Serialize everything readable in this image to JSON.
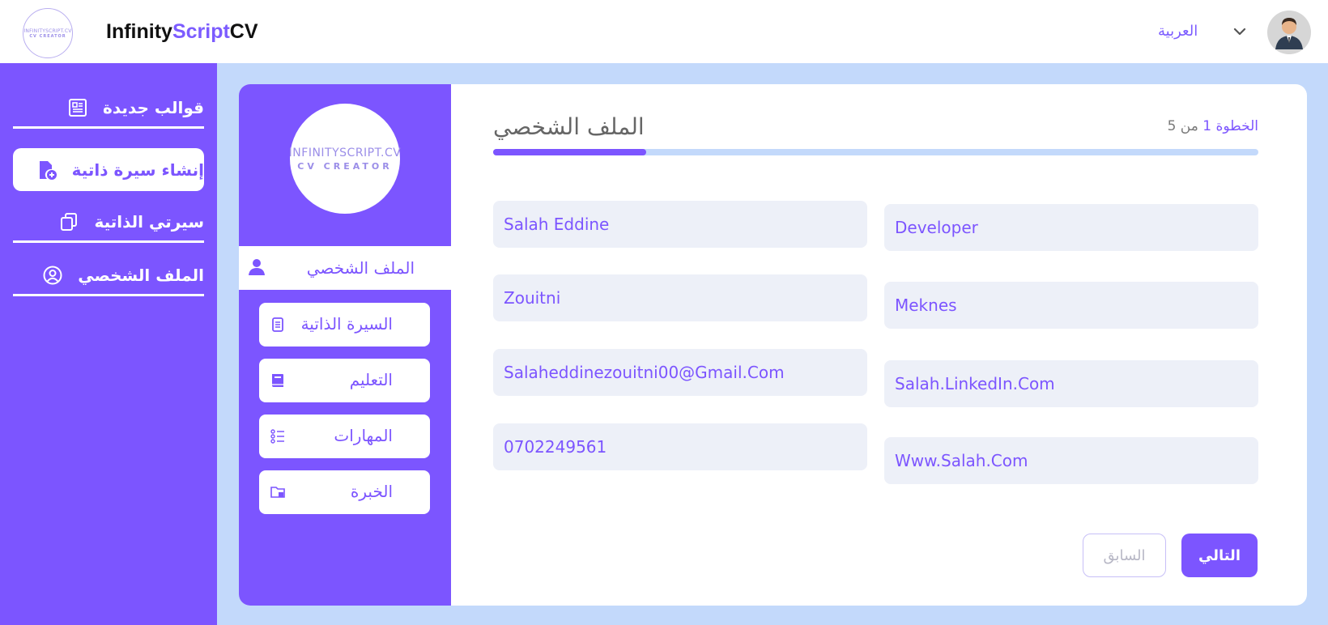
{
  "header": {
    "logo_line1": "INFINITYSCRIPT.CV",
    "logo_line2": "CV CREATOR",
    "brand_part1": "Infinity",
    "brand_part2": "Script",
    "brand_part3": "CV",
    "language": "العربية",
    "icons": {
      "chevron": "chevron-down-icon",
      "avatar": "user-avatar-icon"
    }
  },
  "sidebar": {
    "items": [
      {
        "label": "قوالب جديدة",
        "icon": "templates-icon"
      },
      {
        "label": "إنشاء سيرة ذاتية",
        "icon": "create-cv-icon",
        "active": true
      },
      {
        "label": "سيرتي الذاتية",
        "icon": "my-cv-icon"
      },
      {
        "label": "الملف الشخصي",
        "icon": "profile-icon"
      }
    ]
  },
  "card": {
    "logo_line1": "INFINITYSCRIPT.CV",
    "logo_line2": "CV CREATOR",
    "steps": [
      {
        "label": "الملف الشخصي",
        "icon": "person-icon",
        "active": true
      },
      {
        "label": "السيرة الذاتية",
        "icon": "document-icon"
      },
      {
        "label": "التعليم",
        "icon": "book-icon"
      },
      {
        "label": "المهارات",
        "icon": "list-icon"
      },
      {
        "label": "الخبرة",
        "icon": "folder-icon"
      }
    ],
    "title": "الملف الشخصي",
    "step_prefix": "الخطوة",
    "step_current": "1",
    "step_sep": "من",
    "step_total": "5",
    "progress": 0.2,
    "fields": {
      "first_name": "Salah Eddine",
      "last_name": "Zouitni",
      "email": "Salaheddinezouitni00@Gmail.Com",
      "phone": "0702249561",
      "job_title": "Developer",
      "city": "Meknes",
      "linkedin": "Salah.LinkedIn.Com",
      "website": "Www.Salah.Com"
    },
    "prev_label": "السابق",
    "next_label": "التالي"
  },
  "colors": {
    "accent": "#7c55ff",
    "background": "#c3d9fb",
    "field": "#edf0f8"
  }
}
